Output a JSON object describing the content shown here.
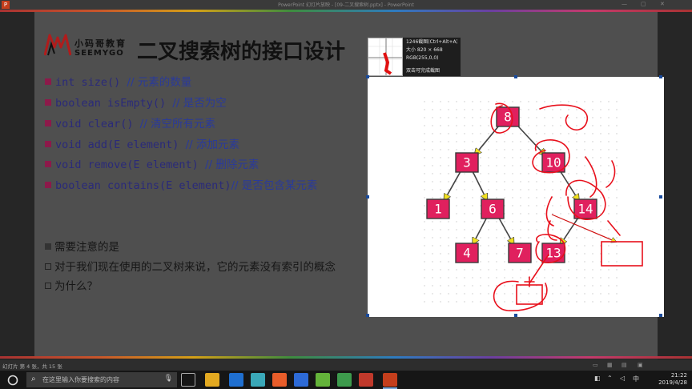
{
  "window": {
    "title": "PowerPoint 幻灯片放映 - [09-二叉搜索树.pptx] - PowerPoint"
  },
  "slide": {
    "title": "二叉搜索树的接口设计",
    "logo": {
      "cn": "小码哥教育",
      "en": "SEEMYGO"
    },
    "interfaces": [
      {
        "code": "int size()   ",
        "comment": "// 元素的数量"
      },
      {
        "code": "boolean isEmpty()   ",
        "comment": "// 是否为空"
      },
      {
        "code": "void clear() ",
        "comment": "// 清空所有元素"
      },
      {
        "code": "void add(E element) ",
        "comment": "// 添加元素"
      },
      {
        "code": "void remove(E element)     ",
        "comment": "// 删除元素"
      },
      {
        "code": "boolean contains(E element)",
        "comment": "// 是否包含某元素"
      }
    ],
    "notes": [
      {
        "marker": "filled",
        "text": "需要注意的是"
      },
      {
        "marker": "outline",
        "text": "对于我们现在使用的二叉树来说，它的元素没有索引的概念"
      },
      {
        "marker": "outline",
        "text": "为什么？"
      }
    ]
  },
  "tree": {
    "node_color": "#e0205e",
    "arrow_color": "#f0e020",
    "nodes": [
      {
        "id": "n8",
        "label": "8"
      },
      {
        "id": "n3",
        "label": "3"
      },
      {
        "id": "n10",
        "label": "10"
      },
      {
        "id": "n1",
        "label": "1"
      },
      {
        "id": "n6",
        "label": "6"
      },
      {
        "id": "n14",
        "label": "14"
      },
      {
        "id": "n4",
        "label": "4"
      },
      {
        "id": "n7",
        "label": "7"
      },
      {
        "id": "n13",
        "label": "13"
      }
    ],
    "edges": [
      [
        "n8",
        "n3"
      ],
      [
        "n8",
        "n10"
      ],
      [
        "n3",
        "n1"
      ],
      [
        "n3",
        "n6"
      ],
      [
        "n10",
        "n14"
      ],
      [
        "n6",
        "n4"
      ],
      [
        "n6",
        "n7"
      ],
      [
        "n14",
        "n13"
      ]
    ]
  },
  "snip_tool": {
    "lines": [
      "1246截图(Ctrl+Alt+A)",
      "大小  820 × 668",
      "RGB(255,0,0)",
      "",
      "双击可完成截图"
    ]
  },
  "statusbar": {
    "text": "幻灯片 第 4 张，共 15 张"
  },
  "taskbar": {
    "search_placeholder": "在这里输入你要搜索的内容",
    "time": "21:22",
    "date": "2019/4/28"
  }
}
